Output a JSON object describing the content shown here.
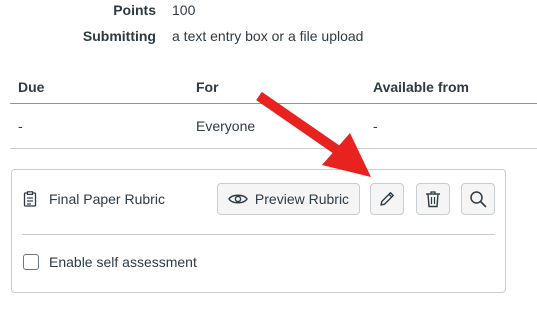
{
  "details": {
    "points_label": "Points",
    "points_value": "100",
    "submitting_label": "Submitting",
    "submitting_value": "a text entry box or a file upload"
  },
  "dates_table": {
    "headers": [
      "Due",
      "For",
      "Available from"
    ],
    "rows": [
      [
        "-",
        "Everyone",
        "-"
      ]
    ]
  },
  "rubric": {
    "title": "Final Paper Rubric",
    "preview_label": "Preview Rubric",
    "self_assessment_label": "Enable self assessment"
  },
  "annotation": {
    "arrow_color": "#e8221f"
  }
}
